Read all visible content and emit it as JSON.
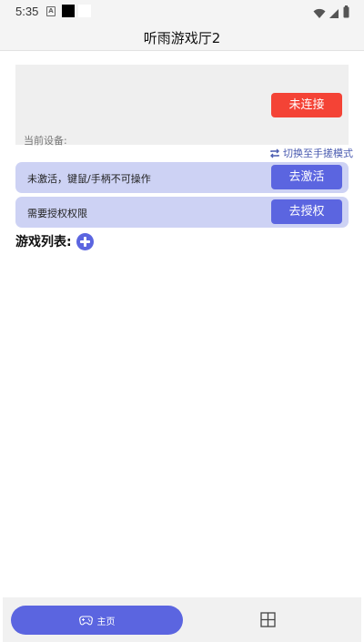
{
  "status_bar": {
    "time": "5:35",
    "a_icon": "A"
  },
  "app_bar": {
    "title": "听雨游戏厅2"
  },
  "device": {
    "connect_label": "未连接",
    "current_device_label": "当前设备:"
  },
  "switch_mode": {
    "label": "切换至手搓模式",
    "icon": "sync-icon"
  },
  "activation": {
    "message": "未激活，键鼠/手柄不可操作",
    "button_label": "去激活"
  },
  "authorization": {
    "message": "需要授权权限",
    "button_label": "去授权"
  },
  "game_list": {
    "title": "游戏列表:",
    "add_icon": "plus-circle-icon"
  },
  "bottom_nav": {
    "home_label": "主页",
    "home_icon": "gamepad-icon",
    "second_icon": "grid-icon"
  },
  "colors": {
    "accent": "#5b65e0",
    "danger": "#f44336",
    "card_bg": "#cdd2f4"
  }
}
